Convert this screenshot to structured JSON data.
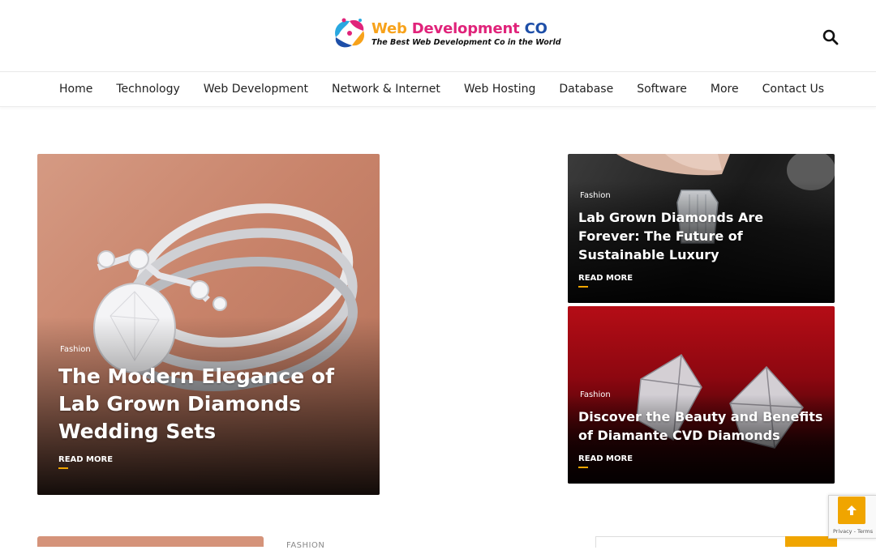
{
  "header": {
    "logo": {
      "title_part1": "Web",
      "title_part2": "Development",
      "title_part3": "CO",
      "tagline": "The Best Web Development Co in the World",
      "colors": [
        "#f7a21b",
        "#e0237a",
        "#1e4fa8",
        "#29a8e0"
      ]
    },
    "search_icon": "search-icon"
  },
  "nav": {
    "items": [
      {
        "label": "Home"
      },
      {
        "label": "Technology"
      },
      {
        "label": "Web Development"
      },
      {
        "label": "Network & Internet"
      },
      {
        "label": "Web Hosting"
      },
      {
        "label": "Database"
      },
      {
        "label": "Software"
      },
      {
        "label": "More"
      },
      {
        "label": "Contact Us"
      }
    ]
  },
  "featured": [
    {
      "category": "Fashion",
      "title": "The Modern Elegance of Lab Grown Diamonds Wedding Sets",
      "read_more": "READ MORE"
    },
    {
      "category": "Fashion",
      "title": "Lab Grown Diamonds Are Forever: The Future of Sustainable Luxury",
      "read_more": "READ MORE"
    },
    {
      "category": "Fashion",
      "title": "Discover the Beauty and Benefits of Diamante CVD Diamonds",
      "read_more": "READ MORE"
    }
  ],
  "below": {
    "category": "FASHION"
  },
  "recaptcha": {
    "links": "Privacy - Terms"
  },
  "colors": {
    "accent": "#f0a500"
  }
}
